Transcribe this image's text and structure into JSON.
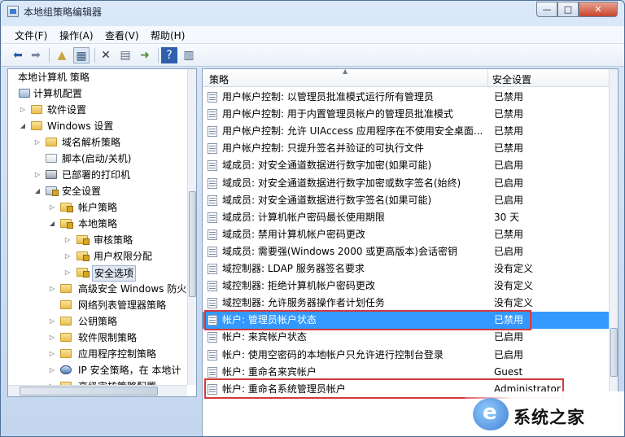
{
  "window": {
    "title": "本地组策略编辑器",
    "min": "—",
    "max": "□",
    "close": "✕"
  },
  "menu": [
    "文件(F)",
    "操作(A)",
    "查看(V)",
    "帮助(H)"
  ],
  "tree": [
    {
      "label": "本地计算机 策略"
    },
    {
      "label": "计算机配置"
    },
    {
      "label": "软件设置"
    },
    {
      "label": "Windows 设置"
    },
    {
      "label": "域名解析策略"
    },
    {
      "label": "脚本(启动/关机)"
    },
    {
      "label": "已部署的打印机"
    },
    {
      "label": "安全设置"
    },
    {
      "label": "帐户策略"
    },
    {
      "label": "本地策略"
    },
    {
      "label": "审核策略"
    },
    {
      "label": "用户权限分配"
    },
    {
      "label": "安全选项"
    },
    {
      "label": "高级安全 Windows 防火"
    },
    {
      "label": "网络列表管理器策略"
    },
    {
      "label": "公钥策略"
    },
    {
      "label": "软件限制策略"
    },
    {
      "label": "应用程序控制策略"
    },
    {
      "label": "IP 安全策略，在 本地计"
    },
    {
      "label": "高级审核策略配置"
    }
  ],
  "list": {
    "col_policy": "策略",
    "col_setting": "安全设置",
    "rows": [
      {
        "name": "用户帐户控制: 以管理员批准模式运行所有管理员",
        "value": "已禁用"
      },
      {
        "name": "用户帐户控制: 用于内置管理员帐户的管理员批准模式",
        "value": "已禁用"
      },
      {
        "name": "用户帐户控制: 允许 UIAccess 应用程序在不使用安全桌面...",
        "value": "已禁用"
      },
      {
        "name": "用户帐户控制: 只提升签名并验证的可执行文件",
        "value": "已禁用"
      },
      {
        "name": "域成员: 对安全通道数据进行数字加密(如果可能)",
        "value": "已启用"
      },
      {
        "name": "域成员: 对安全通道数据进行数字加密或数字签名(始终)",
        "value": "已启用"
      },
      {
        "name": "域成员: 对安全通道数据进行数字签名(如果可能)",
        "value": "已启用"
      },
      {
        "name": "域成员: 计算机帐户密码最长使用期限",
        "value": "30 天"
      },
      {
        "name": "域成员: 禁用计算机帐户密码更改",
        "value": "已禁用"
      },
      {
        "name": "域成员: 需要强(Windows 2000 或更高版本)会话密钥",
        "value": "已启用"
      },
      {
        "name": "域控制器: LDAP 服务器签名要求",
        "value": "没有定义"
      },
      {
        "name": "域控制器: 拒绝计算机帐户密码更改",
        "value": "没有定义"
      },
      {
        "name": "域控制器: 允许服务器操作者计划任务",
        "value": "没有定义"
      },
      {
        "name": "帐户: 管理员帐户状态",
        "value": "已禁用"
      },
      {
        "name": "帐户: 来宾帐户状态",
        "value": "已启用"
      },
      {
        "name": "帐户: 使用空密码的本地帐户只允许进行控制台登录",
        "value": "已启用"
      },
      {
        "name": "帐户: 重命名来宾帐户",
        "value": "Guest"
      },
      {
        "name": "帐户: 重命名系统管理员帐户",
        "value": "Administrator"
      }
    ]
  },
  "watermark": {
    "text": "系统之家"
  }
}
